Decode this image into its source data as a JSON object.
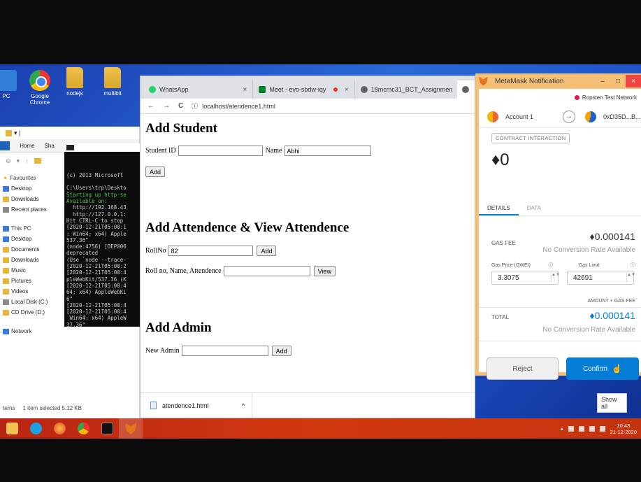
{
  "desktop": {
    "icons": [
      {
        "label": "PC"
      },
      {
        "label": "Google Chrome"
      },
      {
        "label": "nodejs"
      },
      {
        "label": "multibit"
      }
    ]
  },
  "explorer": {
    "ribbon_tabs": [
      "Home",
      "Sha"
    ],
    "nav": {
      "favourites_header": "Favourites",
      "favourites": [
        "Desktop",
        "Downloads",
        "Recent places"
      ],
      "thispc_header": "This PC",
      "thispc": [
        "Desktop",
        "Documents",
        "Downloads",
        "Music",
        "Pictures",
        "Videos",
        "Local Disk (C:)",
        "CD Drive (D:)"
      ],
      "network": "Network"
    },
    "status_items": "tems",
    "status_selected": "1 item selected  5.12 KB"
  },
  "cmd": {
    "lines": [
      "(c) 2013 Microsoft",
      "",
      "C:\\Users\\trp\\Deskto",
      "Starting up http-se",
      "Available on:",
      "  http://192.168.43",
      "  http://127.0.0.1:",
      "Hit CTRL-C to stop",
      "[2020-12-21T05:00:1",
      ": Win64; x64) Apple",
      "537.36\"",
      "(node:4756) [DEP006",
      "deprecated",
      "(Use `node --trace-",
      "[2020-12-21T05:00:2",
      "[2020-12-21T05:00:4",
      "pleWebKit/537.36 (K",
      "[2020-12-21T05:00:4",
      "64; x64) AppleWebKi",
      "6\"",
      "[2020-12-21T05:00:4",
      "[2020-12-21T05:00:4",
      " Win64; x64) AppleW",
      "37.36\""
    ]
  },
  "browser": {
    "tabs": [
      {
        "label": "WhatsApp",
        "color": "#25d366"
      },
      {
        "label": "Meet - evo-sbdw-iqy",
        "color": "#00832d"
      },
      {
        "label": "18mcmc31_BCT_Assignmen",
        "color": "#5f6368"
      },
      {
        "label": "",
        "color": "#5f6368"
      }
    ],
    "tab_close": "×",
    "url": "localhost/atendence1.html",
    "nav_back": "←",
    "nav_forward": "→",
    "nav_reload": "C",
    "info_icon": "ⓘ",
    "page": {
      "add_student_heading": "Add Student",
      "student_id_label": "Student ID",
      "student_id_value": "",
      "name_label": "Name",
      "name_value": "Abhi",
      "add_student_btn": "Add",
      "attendance_heading": "Add Attendence & View Attendence",
      "rollno_label": "RollNo",
      "rollno_value": "82",
      "add_attendance_btn": "Add",
      "view_label": "Roll no, Name, Attendence",
      "view_value": "",
      "view_btn": "View",
      "add_admin_heading": "Add Admin",
      "new_admin_label": "New Admin",
      "new_admin_value": "",
      "add_admin_btn": "Add"
    },
    "download": {
      "filename": "atendence1.html",
      "chevron": "^",
      "show_all": "Show all",
      "close": "×"
    }
  },
  "metamask": {
    "title": "MetaMask Notification",
    "minimize": "–",
    "maximize": "□",
    "close": "×",
    "network": "Ropsten Test Network",
    "account_from": "Account 1",
    "arrow": "→",
    "account_to": "0xD35D...B...",
    "badge": "CONTRACT INTERACTION",
    "amount": "♦0",
    "tab_details": "DETAILS",
    "tab_data": "DATA",
    "gas_fee_label": "GAS FEE",
    "gas_fee_value": "♦0.000141",
    "no_conversion": "No Conversion Rate Available",
    "gas_price_label": "Gas Price (GWEI)",
    "gas_limit_label": "Gas Limit",
    "gas_price_value": "3.3075",
    "gas_limit_value": "42691",
    "info_icon": "ⓘ",
    "spin_arrows": "▲▼",
    "amount_gas_fee": "AMOUNT + GAS FEE",
    "total_label": "TOTAL",
    "total_value": "♦0.000141",
    "total_no_conversion": "No Conversion Rate Available",
    "reject": "Reject",
    "confirm": "Confirm"
  },
  "taskbar": {
    "time": "10:43",
    "date": "21-12-2020"
  },
  "colors": {
    "metamask_blue": "#037dd6",
    "taskbar_red": "#c4340f"
  }
}
